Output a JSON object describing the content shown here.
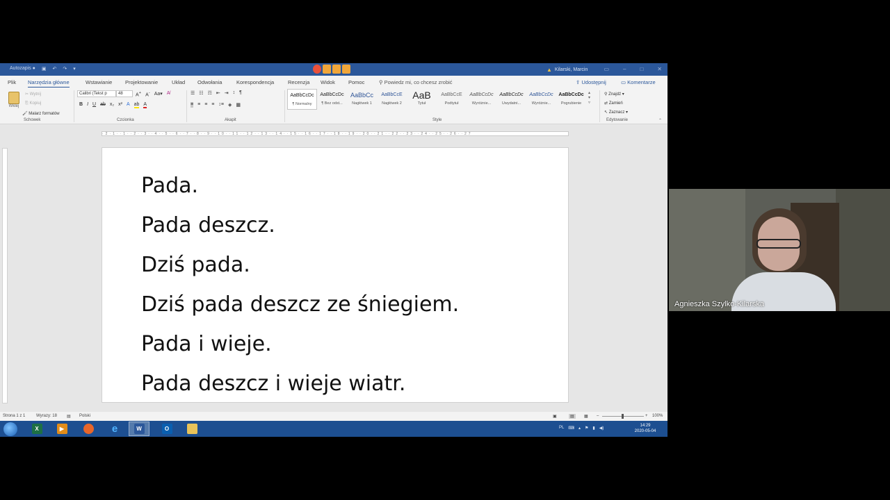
{
  "word": {
    "title_center_note": "",
    "user_name": "Kilarski, Marcin",
    "tabs": [
      "Plik",
      "Narzędzia główne",
      "Wstawianie",
      "Projektowanie",
      "Układ",
      "Odwołania",
      "Korespondencja",
      "Recenzja",
      "Widok",
      "Pomoc"
    ],
    "active_tab": "Narzędzia główne",
    "tell_me": "Powiedz mi, co chcesz zrobić",
    "share": "Udostępnij",
    "comments": "Komentarze",
    "clipboard": {
      "paste": "Wklej",
      "cut": "Wytnij",
      "copy": "Kopiuj",
      "format_painter": "Malarz formatów",
      "label": "Schowek"
    },
    "font": {
      "name": "Calibri (Tekst p",
      "size": "48",
      "label": "Czcionka"
    },
    "paragraph_label": "Akapit",
    "styles": [
      {
        "preview": "AaBbCcDc",
        "name": "¶ Normalny"
      },
      {
        "preview": "AaBbCcDc",
        "name": "¶ Bez odst..."
      },
      {
        "preview": "AaBbCc",
        "name": "Nagłówek 1"
      },
      {
        "preview": "AaBbCcE",
        "name": "Nagłówek 2"
      },
      {
        "preview": "AaB",
        "name": "Tytuł"
      },
      {
        "preview": "AaBbCcE",
        "name": "Podtytuł"
      },
      {
        "preview": "AaBbCcDc",
        "name": "Wyróżnie..."
      },
      {
        "preview": "AaBbCcDc",
        "name": "Uwydatni..."
      },
      {
        "preview": "AaBbCcDc",
        "name": "Wyróżnie..."
      },
      {
        "preview": "AaBbCcDc",
        "name": "Pogrubienie"
      }
    ],
    "styles_label": "Style",
    "editing": {
      "find": "Znajdź",
      "replace": "Zamień",
      "select": "Zaznacz",
      "label": "Edytowanie"
    },
    "document_lines": [
      "Pada.",
      "Pada deszcz.",
      "Dziś pada.",
      "Dziś pada deszcz ze śniegiem.",
      "Pada i wieje.",
      "Pada deszcz i wieje wiatr."
    ],
    "status": {
      "page": "Strona 1 z 1",
      "words": "Wyrazy: 18",
      "language": "Polski",
      "zoom": "100%"
    }
  },
  "taskbar": {
    "apps": [
      "excel",
      "media-player",
      "firefox",
      "internet-explorer",
      "word",
      "outlook",
      "file-explorer"
    ],
    "lang": "PL",
    "time": "14:29",
    "date": "2020-05-04"
  },
  "webcam": {
    "participant_name": "Agnieszka Szylko-Kilarska"
  }
}
